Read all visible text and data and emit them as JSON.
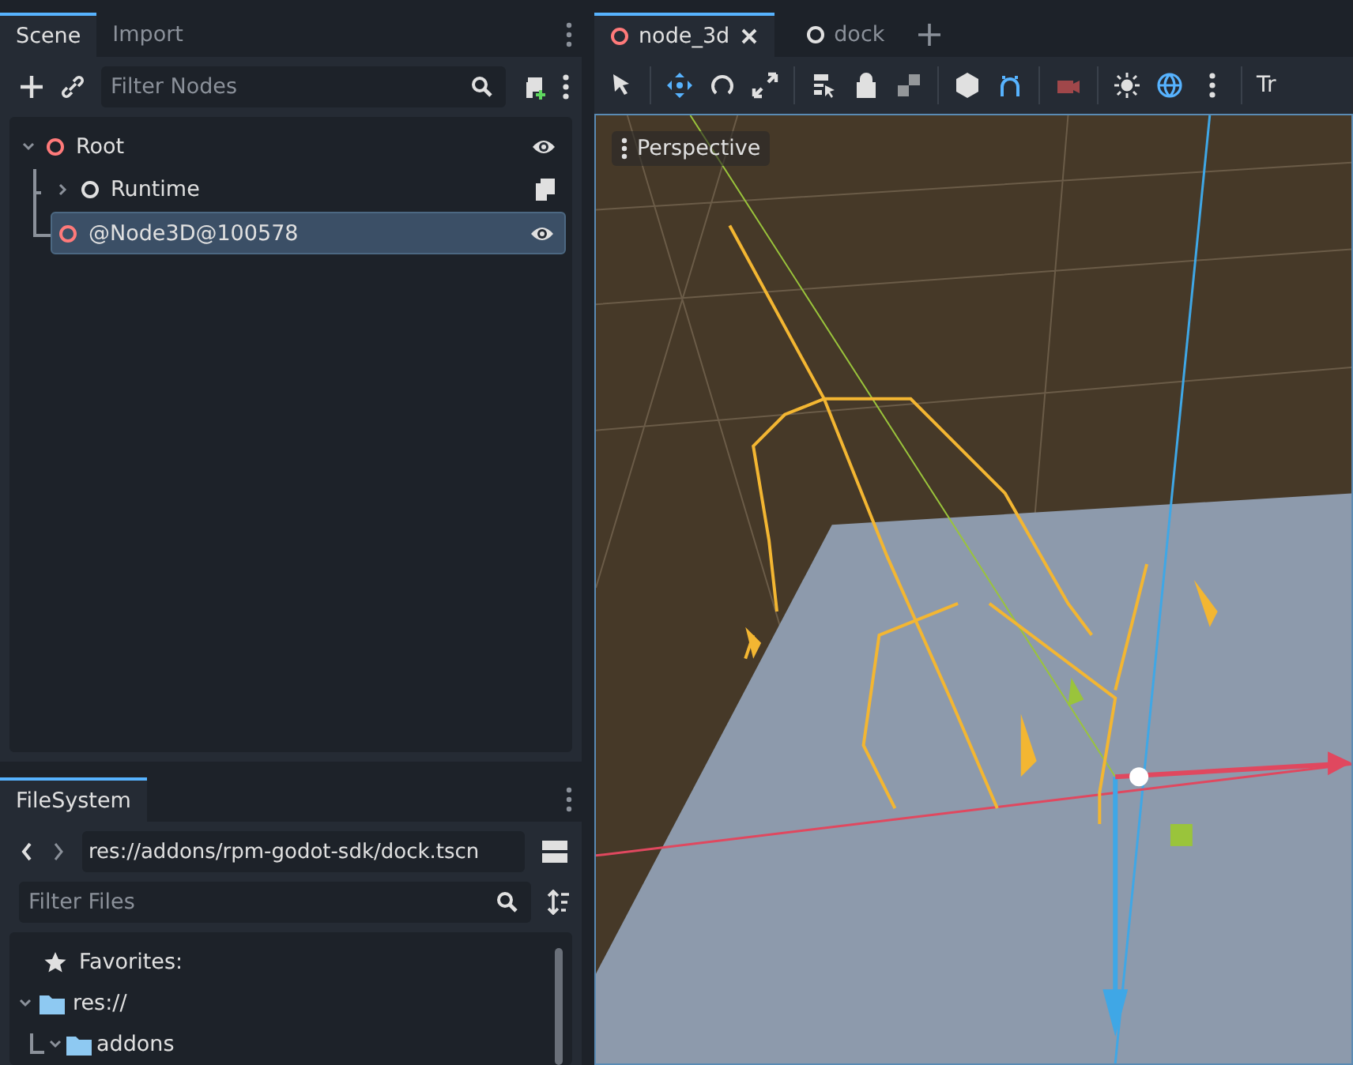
{
  "scene_dock": {
    "tabs": [
      {
        "label": "Scene",
        "selected": true
      },
      {
        "label": "Import",
        "selected": false
      }
    ],
    "filter": {
      "placeholder": "Filter Nodes"
    },
    "tree": [
      {
        "name": "Root",
        "color": "#ff7a7a",
        "expanded": true,
        "selected": false,
        "kind": "visible",
        "children": [
          {
            "name": "Runtime",
            "color": "#e0e0e0",
            "expanded": false,
            "selected": false,
            "kind": "script"
          },
          {
            "name": "@Node3D@100578",
            "color": "#ff7a7a",
            "selected": true,
            "kind": "visible"
          }
        ]
      }
    ]
  },
  "filesystem": {
    "tabs": [
      {
        "label": "FileSystem",
        "selected": true
      }
    ],
    "path": "res://addons/rpm-godot-sdk/dock.tscn",
    "filter": {
      "placeholder": "Filter Files"
    },
    "favorites": "Favorites:",
    "tree": [
      {
        "name": "res://",
        "expanded": true,
        "children": [
          {
            "name": "addons",
            "expanded": true
          }
        ]
      }
    ]
  },
  "editor_tabs": [
    {
      "label": "node_3d",
      "selected": true,
      "color": "#ff7a7a"
    },
    {
      "label": "dock",
      "selected": false,
      "color": "#e0e0e0"
    }
  ],
  "toolbar": {
    "tools": [
      {
        "kind": "select",
        "on": false
      },
      {
        "kind": "move",
        "on": true
      },
      {
        "kind": "rotate",
        "on": false
      },
      {
        "kind": "scale",
        "on": false
      },
      {
        "kind": "list",
        "on": false
      },
      {
        "kind": "lock",
        "on": false
      },
      {
        "kind": "group",
        "on": false
      },
      {
        "kind": "local",
        "on": false
      },
      {
        "kind": "snap",
        "on": true
      },
      {
        "kind": "camera",
        "on": false
      },
      {
        "kind": "sun",
        "on": false
      },
      {
        "kind": "environment",
        "on": true
      },
      {
        "kind": "more",
        "on": false
      }
    ],
    "cut_label": "Tr"
  },
  "viewport": {
    "view_label": "Perspective"
  }
}
